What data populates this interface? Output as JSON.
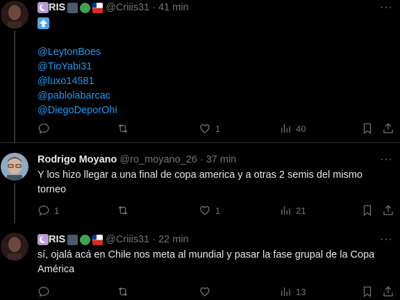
{
  "tweets": [
    {
      "name": "RIS",
      "handle": "@Criiis31",
      "dot": "·",
      "time": "41 min",
      "text_lines": [
        "@LeytonBoes",
        "@TioYabi31",
        "@luxo14581",
        "@pablolabarcac",
        "@DiegoDeporOhi"
      ],
      "stats": {
        "reply": "",
        "retweet": "",
        "like": "1",
        "views": "40"
      }
    },
    {
      "name": "Rodrigo Moyano",
      "handle": "@ro_moyano_26",
      "dot": "·",
      "time": "37 min",
      "text": "Y los hizo llegar a una final de copa america y a otras 2 semis del mismo torneo",
      "stats": {
        "reply": "1",
        "retweet": "",
        "like": "1",
        "views": "21"
      }
    },
    {
      "name": "RIS",
      "handle": "@Criiis31",
      "dot": "·",
      "time": "22 min",
      "text": "sí, ojalá acá en Chile nos meta al mundial y pasar la fase grupal de la Copa América",
      "stats": {
        "reply": "",
        "retweet": "",
        "like": "",
        "views": "13"
      }
    }
  ],
  "more_label": "···",
  "colors": {
    "accent": "#1d9bf0",
    "muted": "#71767b",
    "background": "#000000",
    "text": "#e7e9ea"
  }
}
